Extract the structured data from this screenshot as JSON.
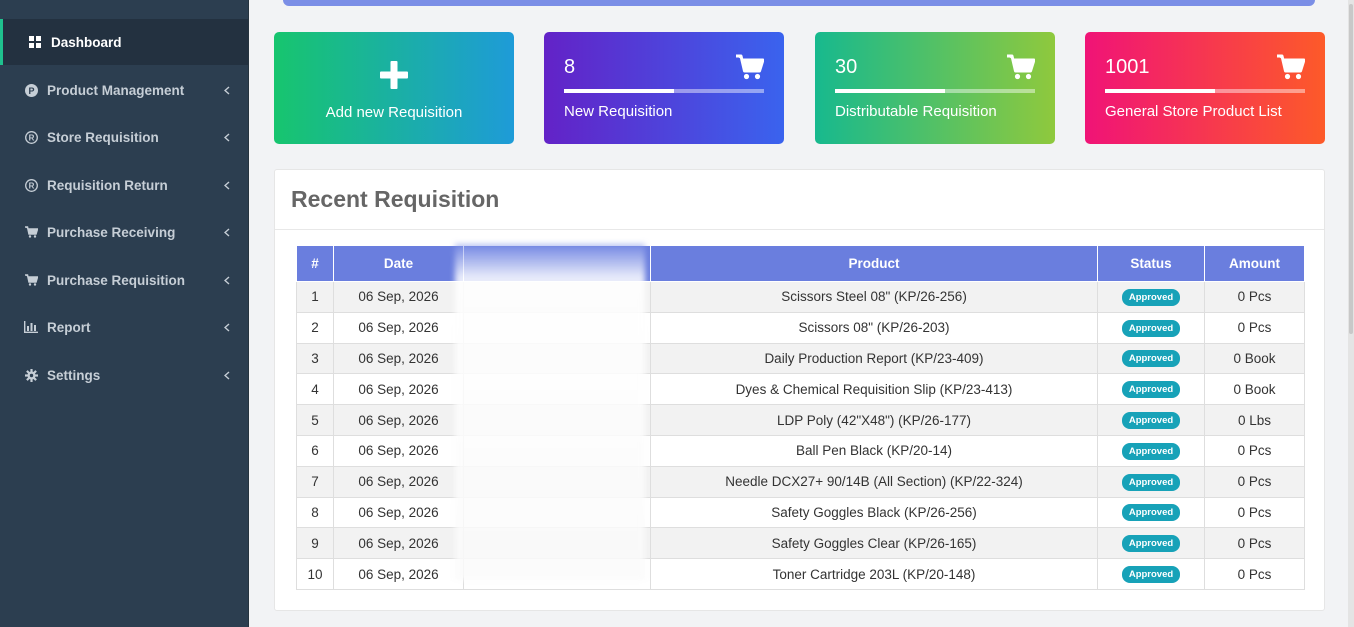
{
  "sidebar": {
    "items": [
      {
        "label": "Dashboard",
        "icon": "grid-icon",
        "active": true
      },
      {
        "label": "Product Management",
        "icon": "p-circle-icon"
      },
      {
        "label": "Store Requisition",
        "icon": "registered-icon"
      },
      {
        "label": "Requisition Return",
        "icon": "registered-icon"
      },
      {
        "label": "Purchase Receiving",
        "icon": "cart-icon"
      },
      {
        "label": "Purchase Requisition",
        "icon": "cart-icon"
      },
      {
        "label": "Report",
        "icon": "bar-chart-icon"
      },
      {
        "label": "Settings",
        "icon": "gear-icon"
      }
    ]
  },
  "cards": {
    "add": {
      "label": "Add new Requisition",
      "icon": "plus-icon"
    },
    "new_req": {
      "count": "8",
      "label": "New Requisition",
      "progress": 0.55,
      "icon": "cart-icon"
    },
    "distributable": {
      "count": "30",
      "label": "Distributable Requisition",
      "progress": 0.55,
      "icon": "cart-icon"
    },
    "general_store": {
      "count": "1001",
      "label": "General Store Product List",
      "progress": 0.55,
      "icon": "cart-icon"
    }
  },
  "recent": {
    "title": "Recent Requisition",
    "columns": [
      "#",
      "Date",
      "",
      "Product",
      "Status",
      "Amount"
    ],
    "rows": [
      {
        "n": "1",
        "date": "06 Sep, 2026",
        "product": "Scissors Steel 08\" (KP/26-256)",
        "status": "Approved",
        "amount": "0 Pcs"
      },
      {
        "n": "2",
        "date": "06 Sep, 2026",
        "product": "Scissors 08\" (KP/26-203)",
        "status": "Approved",
        "amount": "0 Pcs"
      },
      {
        "n": "3",
        "date": "06 Sep, 2026",
        "product": "Daily Production Report (KP/23-409)",
        "status": "Approved",
        "amount": "0 Book"
      },
      {
        "n": "4",
        "date": "06 Sep, 2026",
        "product": "Dyes & Chemical Requisition Slip (KP/23-413)",
        "status": "Approved",
        "amount": "0 Book"
      },
      {
        "n": "5",
        "date": "06 Sep, 2026",
        "product": "LDP Poly (42\"X48\") (KP/26-177)",
        "status": "Approved",
        "amount": "0 Lbs"
      },
      {
        "n": "6",
        "date": "06 Sep, 2026",
        "product": "Ball Pen Black (KP/20-14)",
        "status": "Approved",
        "amount": "0 Pcs"
      },
      {
        "n": "7",
        "date": "06 Sep, 2026",
        "product": "Needle DCX27+ 90/14B (All Section) (KP/22-324)",
        "status": "Approved",
        "amount": "0 Pcs"
      },
      {
        "n": "8",
        "date": "06 Sep, 2026",
        "product": "Safety Goggles Black (KP/26-256)",
        "status": "Approved",
        "amount": "0 Pcs"
      },
      {
        "n": "9",
        "date": "06 Sep, 2026",
        "product": "Safety Goggles Clear (KP/26-165)",
        "status": "Approved",
        "amount": "0 Pcs"
      },
      {
        "n": "10",
        "date": "06 Sep, 2026",
        "product": "Toner Cartridge 203L (KP/20-148)",
        "status": "Approved",
        "amount": "0 Pcs"
      }
    ]
  }
}
